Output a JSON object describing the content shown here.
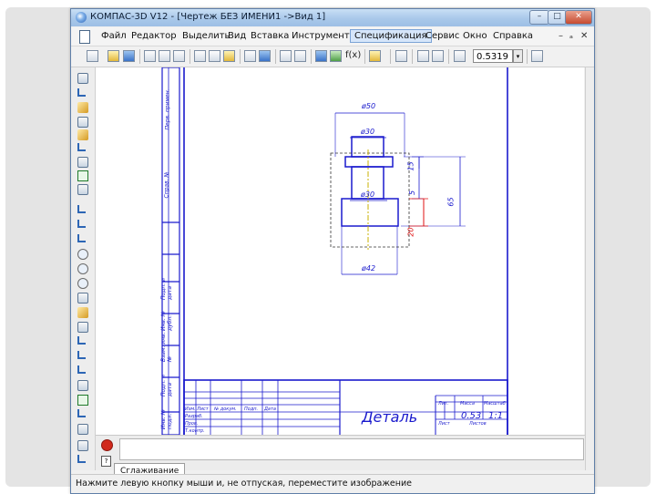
{
  "window": {
    "title": "КОМПАС-3D V12 - [Чертеж БЕЗ ИМЕНИ1 ->Вид 1]",
    "controls": {
      "minimize": "–",
      "maximize": "□",
      "close": "✕"
    }
  },
  "menu": {
    "items": [
      "Файл",
      "Редактор",
      "Выделить",
      "Вид",
      "Вставка",
      "Инструменты",
      "Спецификация",
      "Сервис",
      "Окно",
      "Справка"
    ],
    "active": "Спецификация",
    "mdi_controls": {
      "minimize": "–",
      "restore": "ₐ",
      "close": "✕"
    }
  },
  "toolbar": {
    "fx_label": "f(x)",
    "zoom_value": "0.5319",
    "zoom_drop": "▾"
  },
  "drawing": {
    "dims": {
      "d50": "ø50",
      "d30_top": "ø30",
      "d30_mid": "ø30",
      "d42": "ø42",
      "h15": "15",
      "h5": "5",
      "h20": "20",
      "h65": "65"
    },
    "side_labels": [
      "Подп. и дата",
      "Инв. № дубл.",
      "Взам. инв. №",
      "Подп. и дата",
      "Инв. № подл.",
      "Справ. №",
      "Перв. примен."
    ],
    "title_block": {
      "part_name": "Деталь",
      "letter_label": "Лит.",
      "mass_label": "Масса",
      "scale_label": "Масштаб",
      "mass_value": "0.53",
      "scale_value": "1:1",
      "col_headers": [
        "Изм.",
        "Лист",
        "№ докум.",
        "Подп.",
        "Дата"
      ],
      "row_labels": [
        "Разраб.",
        "Пров.",
        "Т.контр."
      ],
      "sheet_label": "Лист",
      "sheets_label": "Листов"
    }
  },
  "bottom_panel": {
    "tab_label": "Сглаживание",
    "help_glyph": "?"
  },
  "status": {
    "text": "Нажмите левую кнопку мыши и, не отпуская, переместите изображение"
  },
  "colors": {
    "drawing_line": "#1a1acd",
    "dimension_red": "#e01010",
    "hatch_yellow": "#c8b000",
    "active_menu": "#d6e6fa"
  }
}
